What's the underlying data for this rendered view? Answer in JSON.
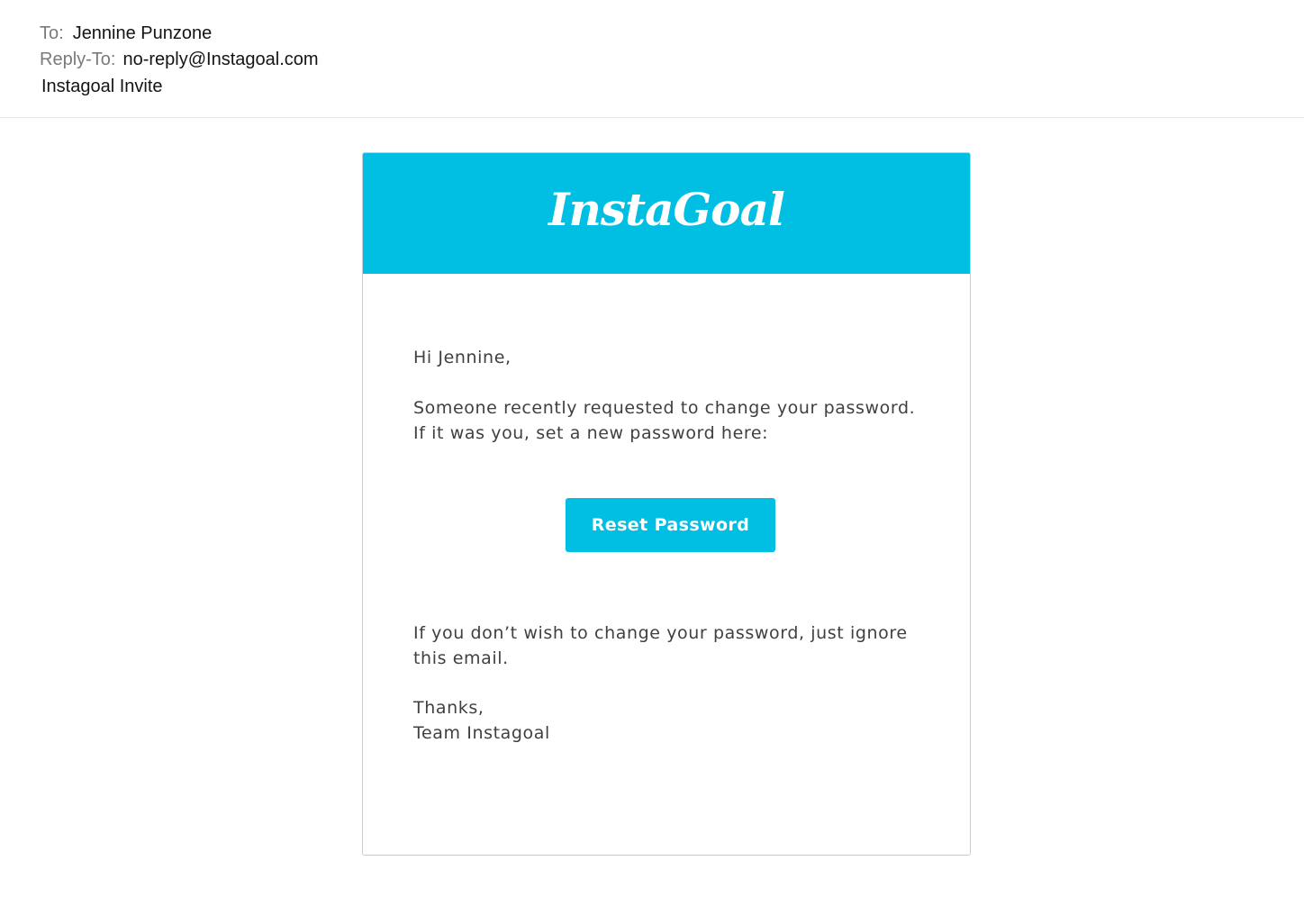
{
  "email_header": {
    "to_label": "To:",
    "to_value": "Jennine Punzone",
    "reply_to_label": "Reply-To:",
    "reply_to_value": "no-reply@Instagoal.com",
    "subject": "Instagoal Invite"
  },
  "email_body": {
    "logo_text": "InstaGoal",
    "brand_color": "#00bfe3",
    "greeting": "Hi Jennine,",
    "paragraph1_line1": "Someone recently requested to change your password.",
    "paragraph1_line2": "If it was you, set a new password here:",
    "button_label": "Reset Password",
    "paragraph2_line1": "If you don’t wish to change your password, just ignore",
    "paragraph2_line2": "this email.",
    "signoff_line1": "Thanks,",
    "signoff_line2": "Team Instagoal"
  }
}
